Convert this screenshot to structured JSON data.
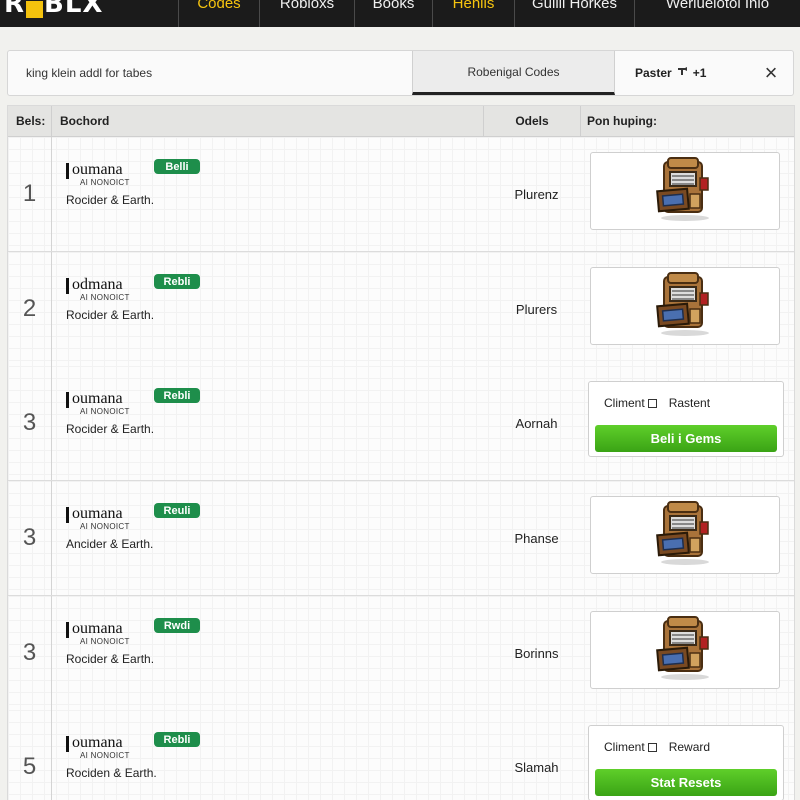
{
  "nav": {
    "logo_left": "R",
    "logo_mid": "BL",
    "logo_right": "X",
    "tabs": [
      "Codes",
      "Robloxs",
      "Books",
      "Hehils",
      "Guilli Horkes",
      "Werluelotol Inio"
    ]
  },
  "toolbar": {
    "search_text": "king klein addl for tabes",
    "active_tab": "Robenigal Codes",
    "paster_label": "Paster",
    "paster_extra": "+1",
    "close_glyph": "×"
  },
  "table": {
    "headers": {
      "num": "Bels:",
      "main": "Bochord",
      "odels": "Odels",
      "pon": "Pon huping:"
    },
    "rows": [
      {
        "num": "1",
        "brand": "oumana",
        "sub": "AI NONOICT",
        "desc": "Rocider & Earth.",
        "badge": "Belli",
        "odels": "Plurenz",
        "media": "image"
      },
      {
        "num": "2",
        "brand": "odmana",
        "sub": "AI NONOICT",
        "desc": "Rocider & Earth.",
        "badge": "Rebli",
        "odels": "Plurers",
        "media": "image"
      },
      {
        "num": "3",
        "brand": "oumana",
        "sub": "AI NONOICT",
        "desc": "Rocider & Earth.",
        "badge": "Rebli",
        "odels": "Aornah",
        "media": "action",
        "action_left": "Climent",
        "action_right": "Rastent",
        "action_button": "Beli i Gems"
      },
      {
        "num": "3",
        "brand": "oumana",
        "sub": "AI NONOICT",
        "desc": "Ancider & Earth.",
        "badge": "Reuli",
        "odels": "Phanse",
        "media": "image"
      },
      {
        "num": "3",
        "brand": "oumana",
        "sub": "AI NONOICT",
        "desc": "Rocider & Earth.",
        "badge": "Rwdi",
        "odels": "Borinns",
        "media": "image"
      },
      {
        "num": "5",
        "brand": "oumana",
        "sub": "AI NONOICT",
        "desc": "Rociden & Earth.",
        "badge": "Rebli",
        "odels": "Slamah",
        "media": "action",
        "action_left": "Climent",
        "action_right": "Reward",
        "action_button": "Stat Resets"
      }
    ]
  },
  "colors": {
    "accent": "#f6c40f",
    "badge": "#1e8e4b",
    "button": "#3aa315"
  },
  "icons": {
    "close": "close-icon",
    "pin": "pin-icon",
    "chest": "treasure-chest-icon",
    "checkbox": "checkbox-icon"
  }
}
